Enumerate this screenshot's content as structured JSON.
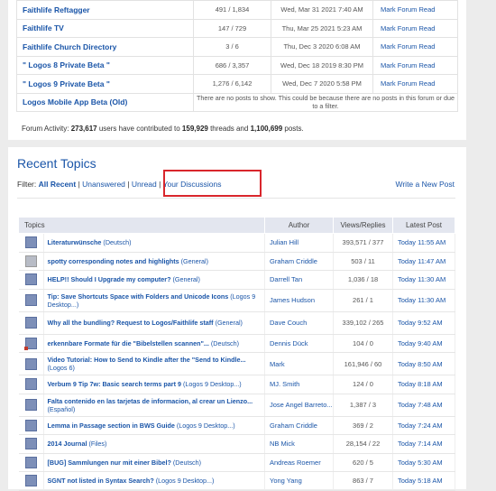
{
  "forums": [
    {
      "name": "Faithlife Reftagger",
      "counts": "491 / 1,834",
      "last_post": "Wed, Mar 31 2021 7:40 AM",
      "action": "Mark Forum Read"
    },
    {
      "name": "Faithlife TV",
      "counts": "147 / 729",
      "last_post": "Thu, Mar 25 2021 5:23 AM",
      "action": "Mark Forum Read"
    },
    {
      "name": "Faithlife Church Directory",
      "counts": "3 / 6",
      "last_post": "Thu, Dec 3 2020 6:08 AM",
      "action": "Mark Forum Read"
    },
    {
      "name": "\" Logos 8 Private Beta \"",
      "counts": "686 / 3,357",
      "last_post": "Wed, Dec 18 2019 8:30 PM",
      "action": "Mark Forum Read"
    },
    {
      "name": "\" Logos 9 Private Beta \"",
      "counts": "1,276 / 6,142",
      "last_post": "Wed, Dec 7 2020 5:58 PM",
      "action": "Mark Forum Read"
    },
    {
      "name": "Logos Mobile App Beta (Old)",
      "note": "There are no posts to show. This could be because there are no posts in this forum or due to a filter."
    }
  ],
  "activity": {
    "prefix": "Forum Activity:",
    "users": "273,617",
    "mid1": "users have contributed to",
    "threads": "159,929",
    "mid2": "threads and",
    "posts": "1,100,699",
    "suffix": "posts."
  },
  "recent": {
    "title": "Recent Topics",
    "filter_label": "Filter:",
    "filters": [
      "All Recent",
      "Unanswered",
      "Unread",
      "Your Discussions"
    ],
    "separator": "|",
    "new_post": "Write a New Post",
    "highlight_color": "#d9262c"
  },
  "table_headers": {
    "topics": "Topics",
    "author": "Author",
    "views": "Views/Replies",
    "latest": "Latest Post"
  },
  "topics": [
    {
      "title": "Literaturwünsche",
      "forum": "(Deutsch)",
      "author": "Julian Hill",
      "views": "393,571 / 377",
      "latest": "Today 11:55 AM",
      "icon": "topic-hot-icon"
    },
    {
      "title": "spotty corresponding notes and highlights",
      "forum": "(General)",
      "author": "Graham Criddle",
      "views": "503 / 11",
      "latest": "Today 11:47 AM",
      "icon": "topic-read-icon"
    },
    {
      "title": "HELP!! Should I Upgrade my computer?",
      "forum": "(General)",
      "author": "Darrell Tan",
      "views": "1,036 / 18",
      "latest": "Today 11:30 AM",
      "icon": "topic-icon"
    },
    {
      "title": "Tip: Save Shortcuts Space with Folders and Unicode Icons",
      "forum": "(Logos 9 Desktop...)",
      "author": "James Hudson",
      "views": "261 / 1",
      "latest": "Today 11:30 AM",
      "icon": "topic-icon"
    },
    {
      "title": "Why all the bundling? Request to Logos/Faithlife staff",
      "forum": "(General)",
      "author": "Dave Couch",
      "views": "339,102 / 265",
      "latest": "Today 9:52 AM",
      "icon": "topic-hot-icon"
    },
    {
      "title": "erkennbare Formate für die \"Bibelstellen scannen\"...",
      "forum": "(Deutsch)",
      "author": "Dennis Dück",
      "views": "104 / 0",
      "latest": "Today 9:40 AM",
      "icon": "topic-flag-icon"
    },
    {
      "title": "Video Tutorial: How to Send to Kindle after the \"Send to Kindle...",
      "forum": "(Logos 6)",
      "author": "Mark",
      "views": "161,946 / 60",
      "latest": "Today 8:50 AM",
      "icon": "topic-hot-icon"
    },
    {
      "title": "Verbum 9 Tip 7w: Basic search terms part 9",
      "forum": "(Logos 9 Desktop...)",
      "author": "MJ. Smith",
      "views": "124 / 0",
      "latest": "Today 8:18 AM",
      "icon": "topic-icon"
    },
    {
      "title": "Falta contenido en las tarjetas de informacion, al crear un Lienzo...",
      "forum": "(Español)",
      "author": "Jose Angel Barreto...",
      "views": "1,387 / 3",
      "latest": "Today 7:48 AM",
      "icon": "topic-icon"
    },
    {
      "title": "Lemma in Passage section in BWS Guide",
      "forum": "(Logos 9 Desktop...)",
      "author": "Graham Criddle",
      "views": "369 / 2",
      "latest": "Today 7:24 AM",
      "icon": "topic-icon"
    },
    {
      "title": "2014 Journal",
      "forum": "(Files)",
      "author": "NB Mick",
      "views": "28,154 / 22",
      "latest": "Today 7:14 AM",
      "icon": "topic-hot-icon"
    },
    {
      "title": "[BUG] Sammlungen nur mit einer Bibel?",
      "forum": "(Deutsch)",
      "author": "Andreas Roemer",
      "views": "620 / 5",
      "latest": "Today 5:30 AM",
      "icon": "topic-icon"
    },
    {
      "title": "SGNT not listed in Syntax Search?",
      "forum": "(Logos 9 Desktop...)",
      "author": "Yong Yang",
      "views": "863 / 7",
      "latest": "Today 5:18 AM",
      "icon": "topic-icon"
    }
  ]
}
